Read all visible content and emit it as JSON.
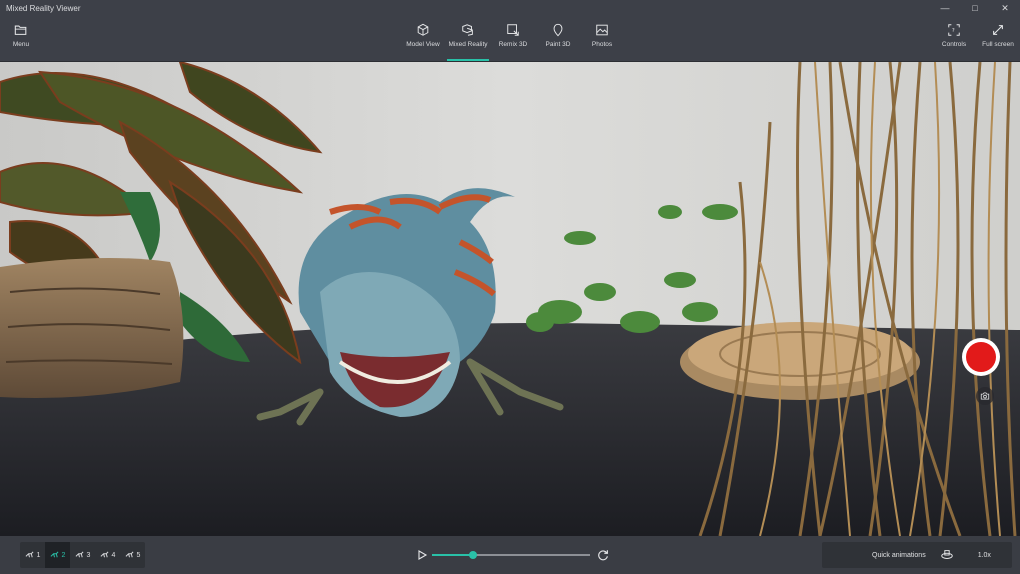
{
  "window": {
    "title": "Mixed Reality Viewer"
  },
  "toolbar": {
    "menu_label": "Menu",
    "tabs": [
      {
        "label": "Model View",
        "icon": "cube-icon"
      },
      {
        "label": "Mixed Reality",
        "icon": "mixed-reality-icon"
      },
      {
        "label": "Remix 3D",
        "icon": "remix-3d-icon"
      },
      {
        "label": "Paint 3D",
        "icon": "paint-3d-icon"
      },
      {
        "label": "Photos",
        "icon": "photos-icon"
      }
    ],
    "active_tab": "Mixed Reality",
    "controls_label": "Controls",
    "fullscreen_label": "Full screen"
  },
  "animations": {
    "buttons": [
      "1",
      "2",
      "3",
      "4",
      "5"
    ],
    "selected": "2"
  },
  "playback": {
    "progress": 0.26
  },
  "quick_animations": {
    "label": "Quick animations",
    "speed": "1.0x"
  },
  "colors": {
    "accent": "#29c1a8",
    "record": "#e21a1a"
  }
}
